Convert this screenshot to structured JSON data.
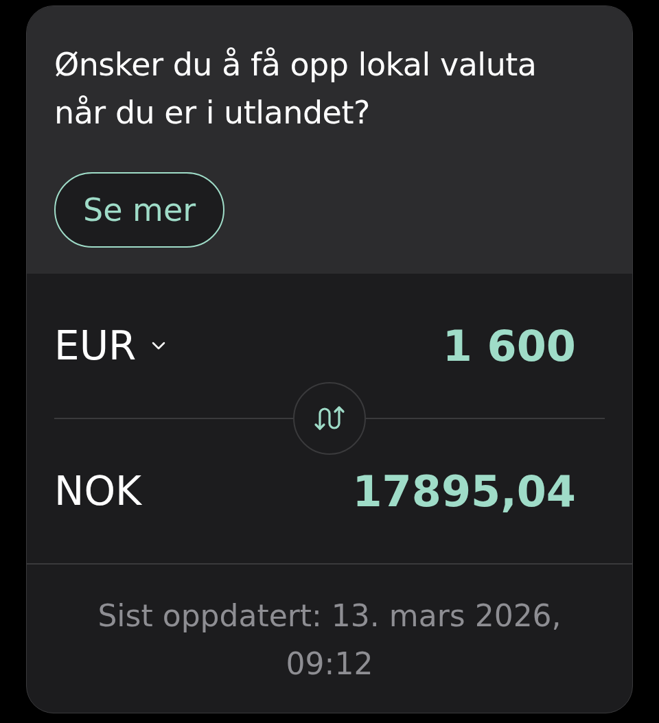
{
  "promo": {
    "question": "Ønsker du å få opp lokal valuta når du er i utlandet?",
    "button": "Se mer"
  },
  "converter": {
    "rows": [
      {
        "currency": "EUR",
        "has_dropdown": true,
        "amount": "1 600"
      },
      {
        "currency": "NOK",
        "has_dropdown": false,
        "amount": "17895,04"
      }
    ]
  },
  "footer": {
    "updated": "Sist oppdatert: 13. mars 2026, 09:12"
  }
}
